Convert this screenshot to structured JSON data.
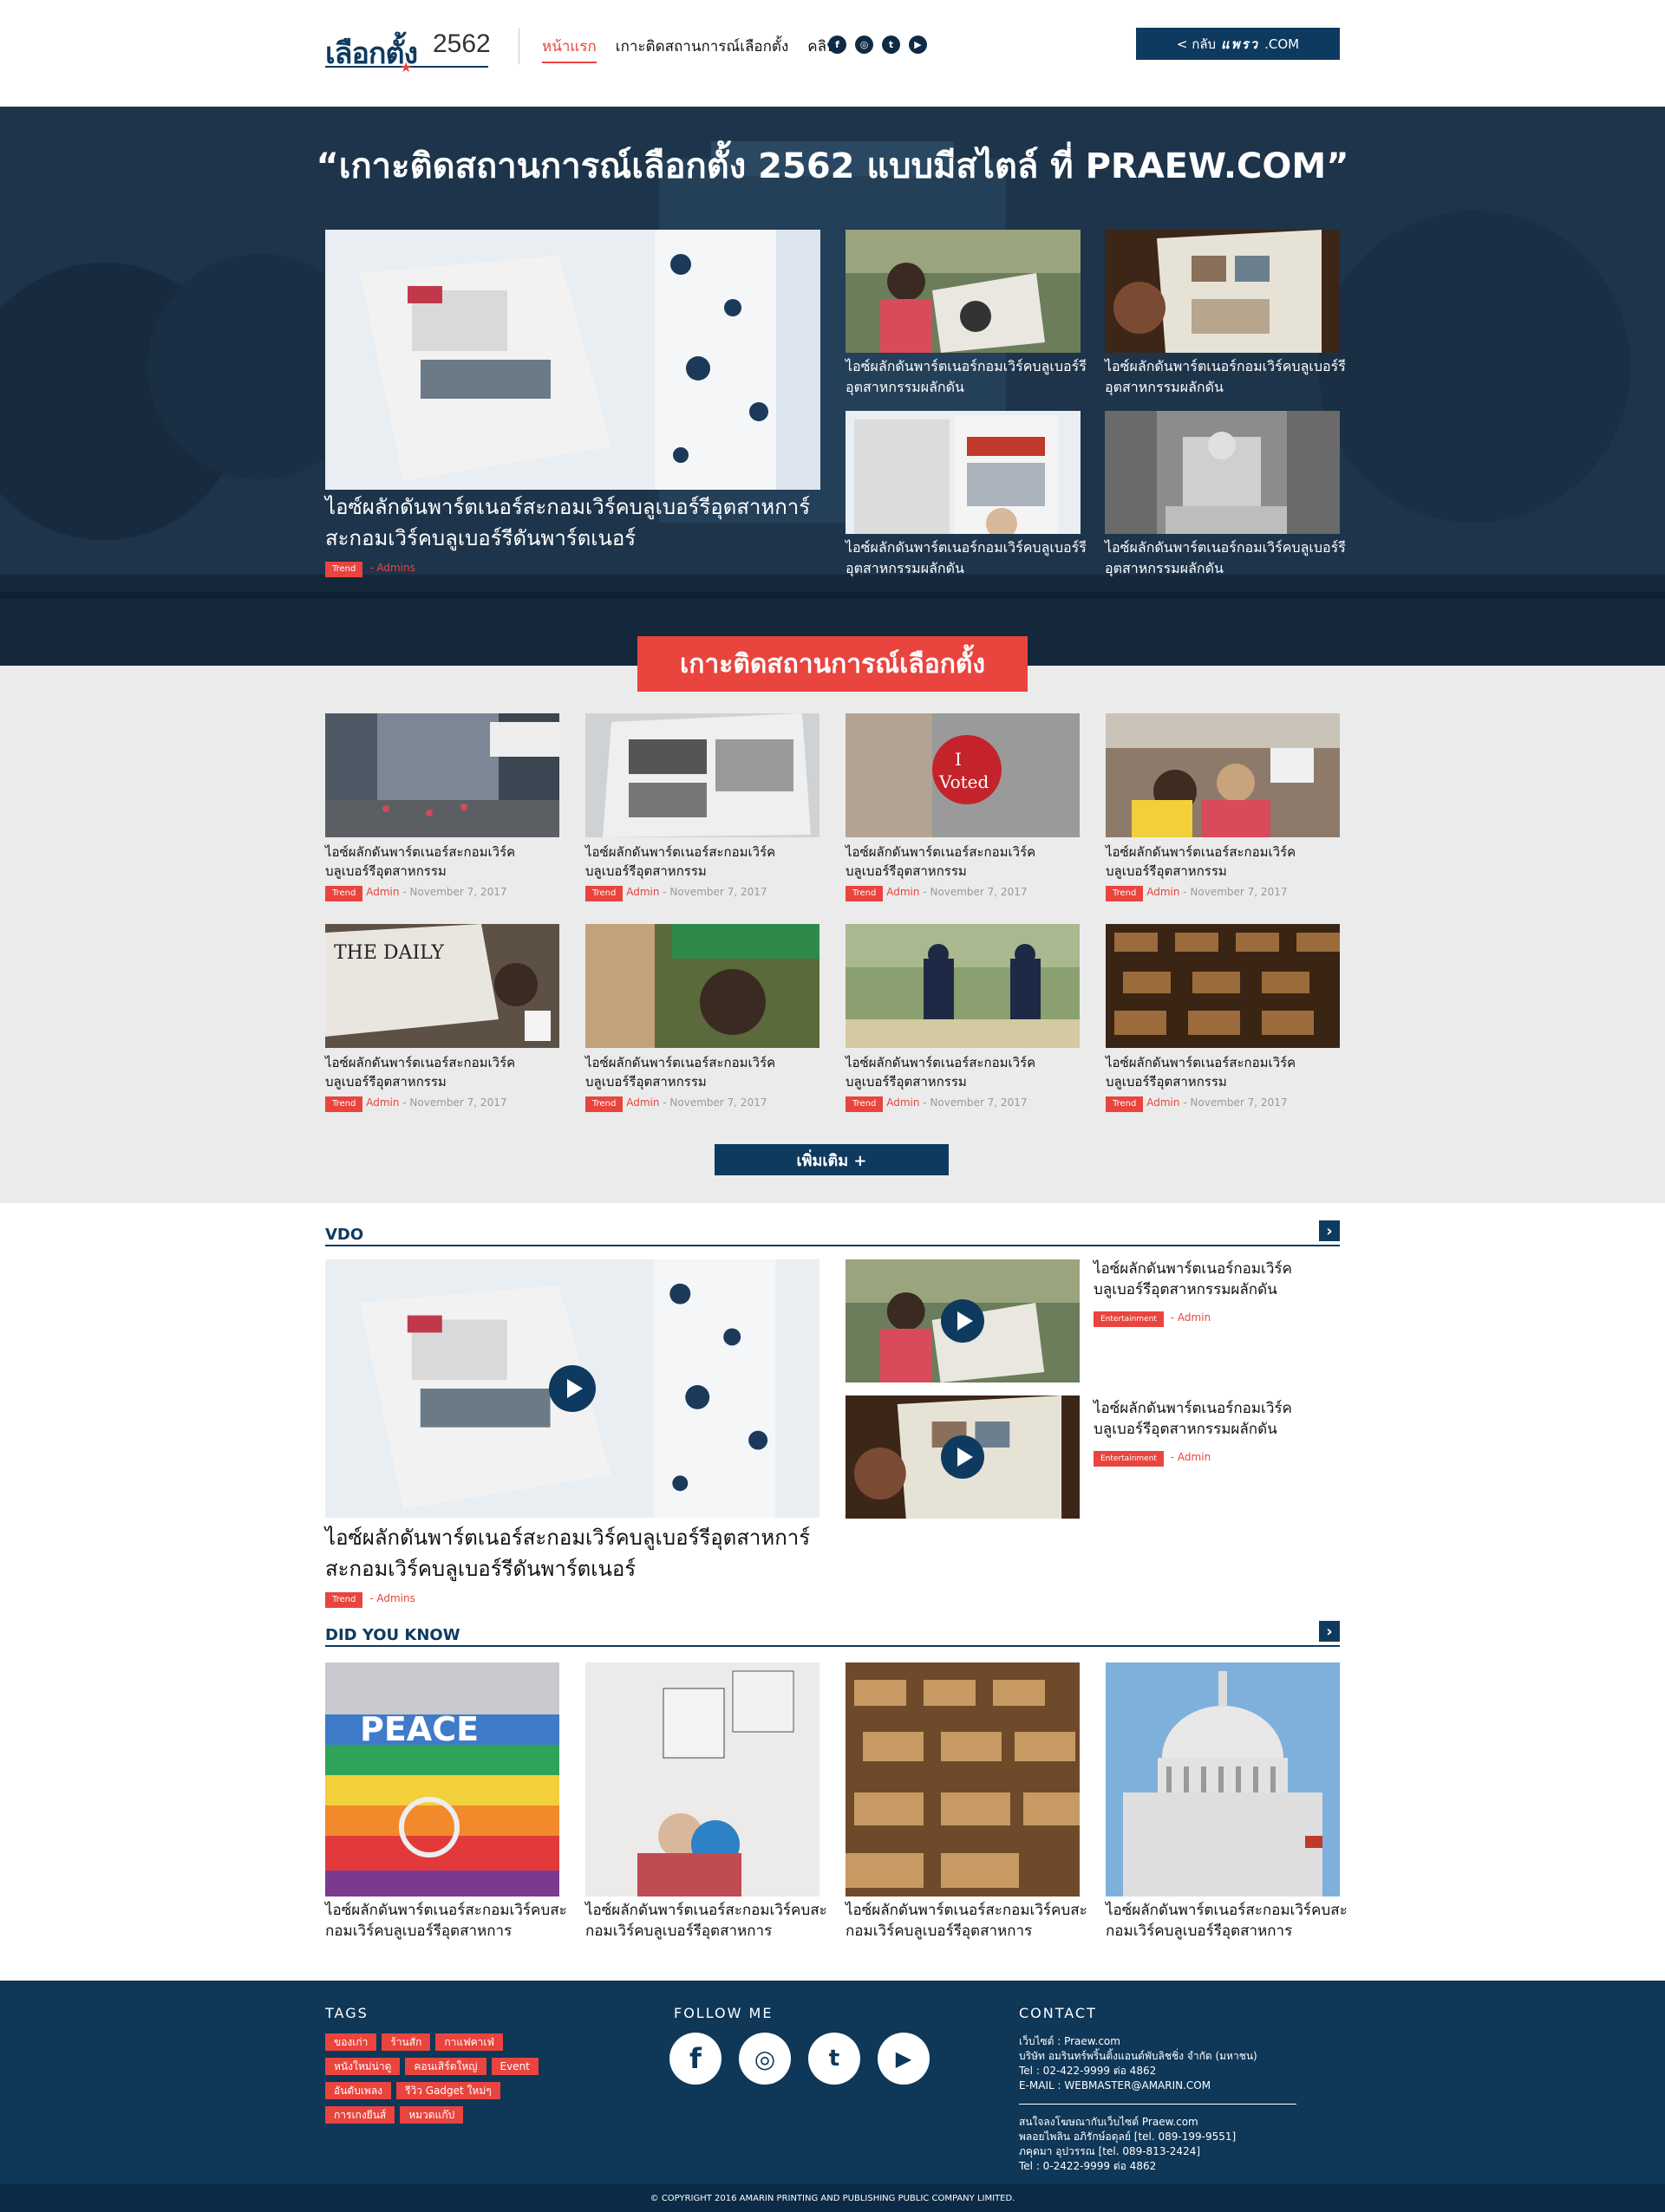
{
  "header": {
    "logo_main": "เลือกตั้ง",
    "logo_year": "2562",
    "nav": [
      "หน้าแรก",
      "เกาะติดสถานการณ์เลือกตั้ง",
      "คลิป"
    ],
    "social": [
      "facebook-icon",
      "instagram-icon",
      "twitter-icon",
      "youtube-icon"
    ],
    "back_label": "< กลับ",
    "back_brand": "แพรว",
    "back_suffix": ".COM"
  },
  "hero": {
    "title": "“เกาะติดสถานการณ์เลือกตั้ง 2562 แบบมีสไตล์ ที่ PRAEW.COM”",
    "main": {
      "title": "ไอซ์ผลักดันพาร์ตเนอร์สะกอมเวิร์คบลูเบอร์รีอุตสาหการ์สะกอมเวิร์คบลูเบอร์รีดันพาร์ตเนอร์",
      "tag": "Trend",
      "author": "- Admins"
    },
    "side": [
      "ไอซ์ผลักดันพาร์ตเนอร์กอมเวิร์คบลูเบอร์รีอุตสาหกรรมผลักดัน",
      "ไอซ์ผลักดันพาร์ตเนอร์กอมเวิร์คบลูเบอร์รีอุตสาหกรรมผลักดัน",
      "ไอซ์ผลักดันพาร์ตเนอร์กอมเวิร์คบลูเบอร์รีอุตสาหกรรมผลักดัน",
      "ไอซ์ผลักดันพาร์ตเนอร์กอมเวิร์คบลูเบอร์รีอุตสาหกรรมผลักดัน"
    ]
  },
  "follow": {
    "title": "เกาะติดสถานการณ์เลือกตั้ง",
    "card_title": "ไอซ์ผลักดันพาร์ตเนอร์สะกอมเวิร์คบลูเบอร์รีอุตสาหกรรม",
    "tag": "Trend",
    "author": "Admin",
    "date": "- November 7, 2017",
    "more": "เพิ่มเติม +"
  },
  "vdo": {
    "label": "VDO",
    "main_title": "ไอซ์ผลักดันพาร์ตเนอร์สะกอมเวิร์คบลูเบอร์รีอุตสาหการ์สะกอมเวิร์คบลูเบอร์รีดันพาร์ตเนอร์",
    "main_tag": "Trend",
    "main_author": "- Admins",
    "side_title": "ไอซ์ผลักดันพาร์ตเนอร์กอมเวิร์คบลูเบอร์รีอุตสาหกรรมผลักดัน",
    "side_tag": "Entertainment",
    "side_author": "- Admin"
  },
  "didyouknow": {
    "label": "DID YOU KNOW",
    "title": "ไอซ์ผลักดันพาร์ตเนอร์สะกอมเวิร์คบสะกอมเวิร์คบลูเบอร์รีอุตสาหการ"
  },
  "footer": {
    "tags_title": "TAGS",
    "follow_title": "FOLLOW ME",
    "contact_title": "CONTACT",
    "tags": [
      "ของเก่า",
      "ร้านสัก",
      "กาแฟคาเฟ่",
      "หนังใหม่น่าดู",
      "คอนเสิร์ตใหญ่",
      "Event",
      "อันดับเพลง",
      "รีวิว Gadget ใหม่ๆ",
      "การเกงยีนส์",
      "หมวดแก๊ป"
    ],
    "contact": [
      "เว็บไซต์ : Praew.com",
      "บริษัท อมรินทร์พริ้นติ้งแอนด์พับลิชชิ่ง จำกัด (มหาชน)",
      "Tel : 02-422-9999 ต่อ 4862",
      "E-MAIL : WEBMASTER@AMARIN.COM"
    ],
    "ads": [
      "สนใจลงโฆษณากับเว็บไซต์ Praew.com",
      "พลอยไพลิน อภิรักษ์อดุลย์ [tel. 089-199-9551]",
      "ภคุดมา อุปวรรณ [tel. 089-813-2424]",
      "Tel : 0-2422-9999 ต่อ 4862"
    ],
    "copyright": "© COPYRIGHT 2016 AMARIN PRINTING AND PUBLISHING PUBLIC COMPANY LIMITED."
  }
}
